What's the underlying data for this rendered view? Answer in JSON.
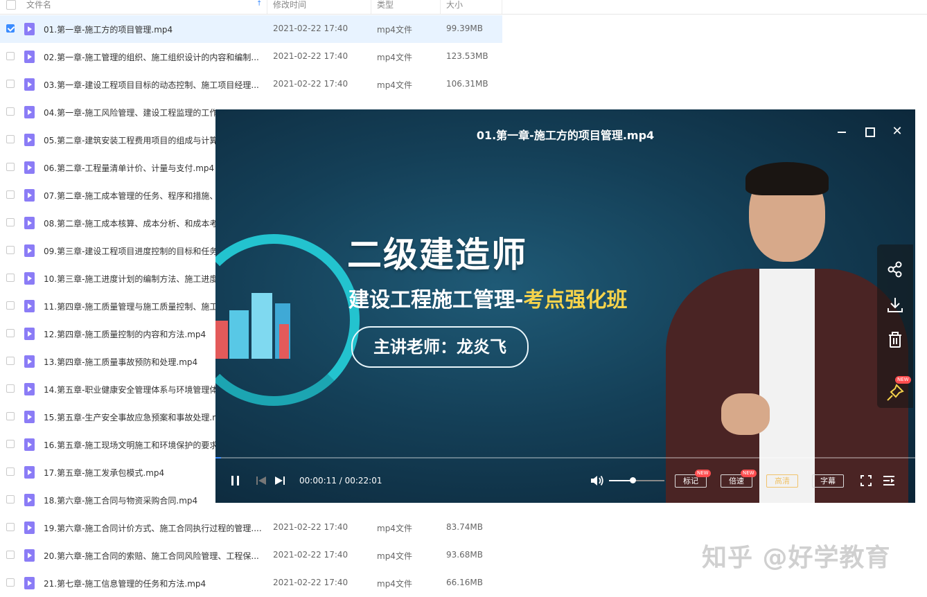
{
  "list_header": {
    "col_name": "文件名",
    "col_time": "修改时间",
    "col_type": "类型",
    "col_size": "大小"
  },
  "files": [
    {
      "name": "01.第一章-施工方的项目管理.mp4",
      "time": "2021-02-22 17:40",
      "type": "mp4文件",
      "size": "99.39MB",
      "selected": true
    },
    {
      "name": "02.第一章-施工管理的组织、施工组织设计的内容和编制...",
      "time": "2021-02-22 17:40",
      "type": "mp4文件",
      "size": "123.53MB"
    },
    {
      "name": "03.第一章-建设工程项目目标的动态控制、施工项目经理...",
      "time": "2021-02-22 17:40",
      "type": "mp4文件",
      "size": "106.31MB"
    },
    {
      "name": "04.第一章-施工风险管理、建设工程监理的工作",
      "time": "",
      "type": "",
      "size": ""
    },
    {
      "name": "05.第二章-建筑安装工程费用项目的组成与计算",
      "time": "",
      "type": "",
      "size": ""
    },
    {
      "name": "06.第二章-工程量清单计价、计量与支付.mp4",
      "time": "",
      "type": "",
      "size": ""
    },
    {
      "name": "07.第二章-施工成本管理的任务、程序和措施、",
      "time": "",
      "type": "",
      "size": ""
    },
    {
      "name": "08.第二章-施工成本核算、成本分析、和成本考",
      "time": "",
      "type": "",
      "size": ""
    },
    {
      "name": "09.第三章-建设工程项目进度控制的目标和任务",
      "time": "",
      "type": "",
      "size": ""
    },
    {
      "name": "10.第三章-施工进度计划的编制方法、施工进度",
      "time": "",
      "type": "",
      "size": ""
    },
    {
      "name": "11.第四章-施工质量管理与施工质量控制、施工",
      "time": "",
      "type": "",
      "size": ""
    },
    {
      "name": "12.第四章-施工质量控制的内容和方法.mp4",
      "time": "",
      "type": "",
      "size": ""
    },
    {
      "name": "13.第四章-施工质量事故预防和处理.mp4",
      "time": "",
      "type": "",
      "size": ""
    },
    {
      "name": "14.第五章-职业健康安全管理体系与环境管理体",
      "time": "",
      "type": "",
      "size": ""
    },
    {
      "name": "15.第五章-生产安全事故应急预案和事故处理.m",
      "time": "",
      "type": "",
      "size": ""
    },
    {
      "name": "16.第五章-施工现场文明施工和环境保护的要求",
      "time": "",
      "type": "",
      "size": ""
    },
    {
      "name": "17.第五章-施工发承包模式.mp4",
      "time": "",
      "type": "",
      "size": ""
    },
    {
      "name": "18.第六章-施工合同与物资采购合同.mp4",
      "time": "",
      "type": "",
      "size": ""
    },
    {
      "name": "19.第六章-施工合同计价方式、施工合同执行过程的管理....",
      "time": "2021-02-22 17:40",
      "type": "mp4文件",
      "size": "83.74MB"
    },
    {
      "name": "20.第六章-施工合同的索赔、施工合同风险管理、工程保...",
      "time": "2021-02-22 17:40",
      "type": "mp4文件",
      "size": "93.68MB"
    },
    {
      "name": "21.第七章-施工信息管理的任务和方法.mp4",
      "time": "2021-02-22 17:40",
      "type": "mp4文件",
      "size": "66.16MB"
    }
  ],
  "player": {
    "title": "01.第一章-施工方的项目管理.mp4",
    "video": {
      "headline": "二级建造师",
      "subtitle_main": "建设工程施工管理-",
      "subtitle_highlight": "考点强化班",
      "teacher": "主讲老师：龙炎飞"
    },
    "time_current": "00:00:11",
    "time_sep": " / ",
    "time_total": "00:22:01",
    "progress_fraction": 0.008,
    "volume_fraction": 0.42,
    "buttons": {
      "mark": "标记",
      "speed": "倍速",
      "quality": "高清",
      "subtitle": "字幕",
      "new_badge": "NEW"
    },
    "close_glyph": "✕"
  },
  "watermark": "知乎 @好学教育",
  "colors": {
    "accent": "#3b8cff",
    "file_icon": "#8b7cf6",
    "highlight_text": "#f6d34b"
  }
}
